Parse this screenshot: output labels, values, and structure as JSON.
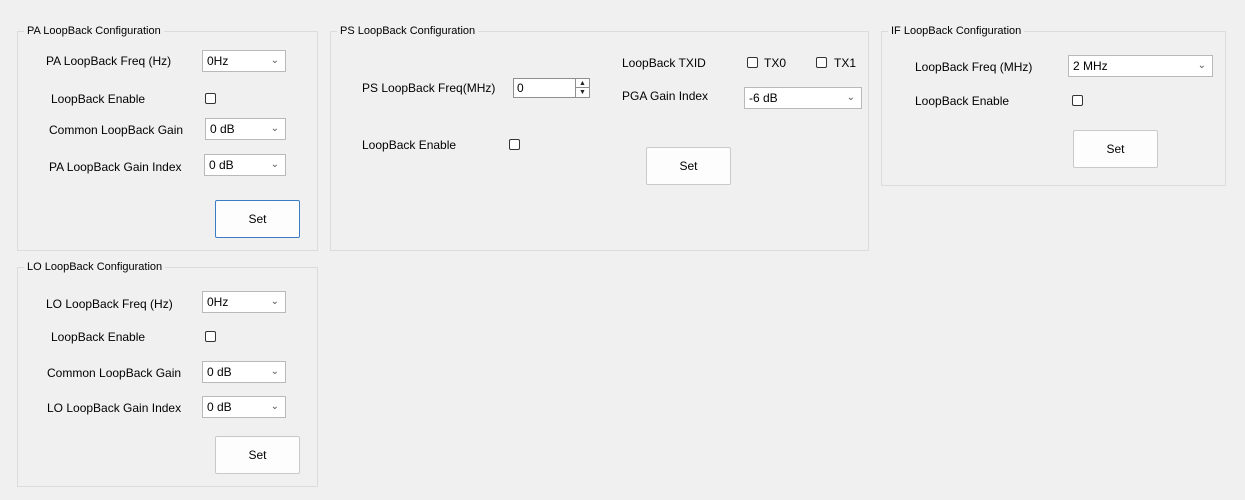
{
  "pa": {
    "title": "PA LoopBack Configuration",
    "freq_label": "PA LoopBack Freq (Hz)",
    "freq_value": "0Hz",
    "enable_label": "LoopBack Enable",
    "common_gain_label": "Common LoopBack Gain",
    "common_gain_value": "0 dB",
    "gain_index_label": "PA LoopBack Gain Index",
    "gain_index_value": "0 dB",
    "set_label": "Set"
  },
  "ps": {
    "title": "PS LoopBack Configuration",
    "freq_label": "PS LoopBack Freq(MHz)",
    "freq_value": "0",
    "enable_label": "LoopBack Enable",
    "txid_label": "LoopBack TXID",
    "tx0_label": "TX0",
    "tx1_label": "TX1",
    "pga_label": "PGA Gain Index",
    "pga_value": "-6 dB",
    "set_label": "Set"
  },
  "if": {
    "title": "IF LoopBack Configuration",
    "freq_label": "LoopBack Freq (MHz)",
    "freq_value": "2 MHz",
    "enable_label": "LoopBack Enable",
    "set_label": "Set"
  },
  "lo": {
    "title": "LO LoopBack Configuration",
    "freq_label": "LO LoopBack Freq (Hz)",
    "freq_value": "0Hz",
    "enable_label": "LoopBack Enable",
    "common_gain_label": "Common LoopBack Gain",
    "common_gain_value": "0 dB",
    "gain_index_label": "LO LoopBack Gain Index",
    "gain_index_value": "0 dB",
    "set_label": "Set"
  },
  "icons": {
    "chevron": "chevron-down-icon",
    "spin_up": "spin-up-icon",
    "spin_down": "spin-down-icon"
  }
}
